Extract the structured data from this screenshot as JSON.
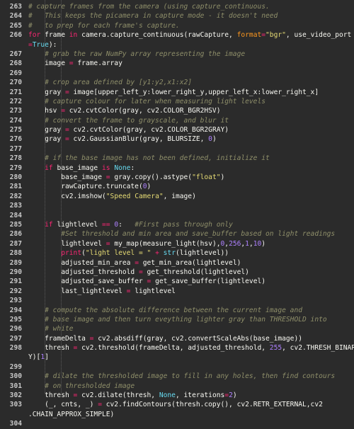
{
  "editor": {
    "lines": [
      {
        "num": "263",
        "indent": 0,
        "tokens": [
          [
            "cm",
            "# capture frames from the camera (using capture_continuous."
          ]
        ]
      },
      {
        "num": "264",
        "indent": 0,
        "tokens": [
          [
            "cm",
            "#   This keeps the picamera in capture mode - it doesn't need"
          ]
        ]
      },
      {
        "num": "265",
        "indent": 0,
        "tokens": [
          [
            "cm",
            "#   to prep for each frame's capture."
          ]
        ]
      },
      {
        "num": "266",
        "indent": 0,
        "tokens": [
          [
            "kw",
            "for"
          ],
          [
            "tx",
            " frame "
          ],
          [
            "kw",
            "in"
          ],
          [
            "tx",
            " camera.capture_continuous(rawCapture, "
          ],
          [
            "pa",
            "format"
          ],
          [
            "op",
            "="
          ],
          [
            "st",
            "\"bgr\""
          ],
          [
            "tx",
            ", use_video_port"
          ]
        ]
      },
      {
        "num": "",
        "indent": 0,
        "tokens": [
          [
            "op",
            "="
          ],
          [
            "bi",
            "True"
          ],
          [
            "tx",
            "):"
          ]
        ]
      },
      {
        "num": "267",
        "indent": 1,
        "tokens": [
          [
            "cm",
            "# grab the raw NumPy array representing the image"
          ]
        ]
      },
      {
        "num": "268",
        "indent": 1,
        "tokens": [
          [
            "tx",
            "image "
          ],
          [
            "op",
            "="
          ],
          [
            "tx",
            " frame.array"
          ]
        ]
      },
      {
        "num": "269",
        "indent": 0,
        "tokens": []
      },
      {
        "num": "270",
        "indent": 1,
        "tokens": [
          [
            "cm",
            "# crop area defined by [y1:y2,x1:x2]"
          ]
        ]
      },
      {
        "num": "271",
        "indent": 1,
        "tokens": [
          [
            "tx",
            "gray "
          ],
          [
            "op",
            "="
          ],
          [
            "tx",
            " image[upper_left_y:lower_right_y,upper_left_x:lower_right_x]"
          ]
        ]
      },
      {
        "num": "272",
        "indent": 1,
        "tokens": [
          [
            "cm",
            "# capture colour for later when measuring light levels"
          ]
        ]
      },
      {
        "num": "273",
        "indent": 1,
        "tokens": [
          [
            "tx",
            "hsv "
          ],
          [
            "op",
            "="
          ],
          [
            "tx",
            " cv2.cvtColor(gray, cv2.COLOR_BGR2HSV)"
          ]
        ]
      },
      {
        "num": "274",
        "indent": 1,
        "tokens": [
          [
            "cm",
            "# convert the frame to grayscale, and blur it"
          ]
        ]
      },
      {
        "num": "275",
        "indent": 1,
        "tokens": [
          [
            "tx",
            "gray "
          ],
          [
            "op",
            "="
          ],
          [
            "tx",
            " cv2.cvtColor(gray, cv2.COLOR_BGR2GRAY)"
          ]
        ]
      },
      {
        "num": "276",
        "indent": 1,
        "tokens": [
          [
            "tx",
            "gray "
          ],
          [
            "op",
            "="
          ],
          [
            "tx",
            " cv2.GaussianBlur(gray, BLURSIZE, "
          ],
          [
            "nu",
            "0"
          ],
          [
            "tx",
            ")"
          ]
        ]
      },
      {
        "num": "277",
        "indent": 0,
        "tokens": []
      },
      {
        "num": "278",
        "indent": 1,
        "tokens": [
          [
            "cm",
            "# if the base image has not been defined, initialize it"
          ]
        ]
      },
      {
        "num": "279",
        "indent": 1,
        "tokens": [
          [
            "kw",
            "if"
          ],
          [
            "tx",
            " base_image "
          ],
          [
            "kw",
            "is"
          ],
          [
            "tx",
            " "
          ],
          [
            "bi",
            "None"
          ],
          [
            "tx",
            ":"
          ]
        ]
      },
      {
        "num": "280",
        "indent": 2,
        "tokens": [
          [
            "tx",
            "base_image "
          ],
          [
            "op",
            "="
          ],
          [
            "tx",
            " gray.copy().astype("
          ],
          [
            "st",
            "\"float\""
          ],
          [
            "tx",
            ")"
          ]
        ]
      },
      {
        "num": "281",
        "indent": 2,
        "tokens": [
          [
            "tx",
            "rawCapture.truncate("
          ],
          [
            "nu",
            "0"
          ],
          [
            "tx",
            ")"
          ]
        ]
      },
      {
        "num": "282",
        "indent": 2,
        "tokens": [
          [
            "tx",
            "cv2.imshow("
          ],
          [
            "st",
            "\"Speed Camera\""
          ],
          [
            "tx",
            ", image)"
          ]
        ]
      },
      {
        "num": "283",
        "indent": 0,
        "tokens": []
      },
      {
        "num": "284",
        "indent": 0,
        "tokens": []
      },
      {
        "num": "285",
        "indent": 1,
        "tokens": [
          [
            "kw",
            "if"
          ],
          [
            "tx",
            " lightlevel "
          ],
          [
            "op",
            "=="
          ],
          [
            "tx",
            " "
          ],
          [
            "nu",
            "0"
          ],
          [
            "tx",
            ":   "
          ],
          [
            "cm",
            "#First pass through only"
          ]
        ]
      },
      {
        "num": "286",
        "indent": 2,
        "tokens": [
          [
            "cm",
            "#Set threshold and min area and save_buffer based on light readings"
          ]
        ]
      },
      {
        "num": "287",
        "indent": 2,
        "tokens": [
          [
            "tx",
            "lightlevel "
          ],
          [
            "op",
            "="
          ],
          [
            "tx",
            " my_map(measure_light(hsv),"
          ],
          [
            "nu",
            "0"
          ],
          [
            "tx",
            ","
          ],
          [
            "nu",
            "256"
          ],
          [
            "tx",
            ","
          ],
          [
            "nu",
            "1"
          ],
          [
            "tx",
            ","
          ],
          [
            "nu",
            "10"
          ],
          [
            "tx",
            ")"
          ]
        ]
      },
      {
        "num": "288",
        "indent": 2,
        "tokens": [
          [
            "kw",
            "print"
          ],
          [
            "tx",
            "("
          ],
          [
            "st",
            "\"light level = \""
          ],
          [
            "tx",
            " "
          ],
          [
            "op",
            "+"
          ],
          [
            "tx",
            " "
          ],
          [
            "bi",
            "str"
          ],
          [
            "tx",
            "(lightlevel))"
          ]
        ]
      },
      {
        "num": "289",
        "indent": 2,
        "tokens": [
          [
            "tx",
            "adjusted_min_area "
          ],
          [
            "op",
            "="
          ],
          [
            "tx",
            " get_min_area(lightlevel)"
          ]
        ]
      },
      {
        "num": "290",
        "indent": 2,
        "tokens": [
          [
            "tx",
            "adjusted_threshold "
          ],
          [
            "op",
            "="
          ],
          [
            "tx",
            " get_threshold(lightlevel)"
          ]
        ]
      },
      {
        "num": "291",
        "indent": 2,
        "tokens": [
          [
            "tx",
            "adjusted_save_buffer "
          ],
          [
            "op",
            "="
          ],
          [
            "tx",
            " get_save_buffer(lightlevel)"
          ]
        ]
      },
      {
        "num": "292",
        "indent": 2,
        "tokens": [
          [
            "tx",
            "last_lightlevel "
          ],
          [
            "op",
            "="
          ],
          [
            "tx",
            " lightlevel"
          ]
        ]
      },
      {
        "num": "293",
        "indent": 0,
        "tokens": []
      },
      {
        "num": "294",
        "indent": 1,
        "tokens": [
          [
            "cm",
            "# compute the absolute difference between the current image and"
          ]
        ]
      },
      {
        "num": "295",
        "indent": 1,
        "tokens": [
          [
            "cm",
            "# base image and then turn eveything lighter gray than THRESHOLD into"
          ]
        ]
      },
      {
        "num": "296",
        "indent": 1,
        "tokens": [
          [
            "cm",
            "# white"
          ]
        ]
      },
      {
        "num": "297",
        "indent": 1,
        "tokens": [
          [
            "tx",
            "frameDelta "
          ],
          [
            "op",
            "="
          ],
          [
            "tx",
            " cv2.absdiff(gray, cv2.convertScaleAbs(base_image))"
          ]
        ]
      },
      {
        "num": "298",
        "indent": 1,
        "tokens": [
          [
            "tx",
            "thresh "
          ],
          [
            "op",
            "="
          ],
          [
            "tx",
            " cv2.threshold(frameDelta, adjusted_threshold, "
          ],
          [
            "nu",
            "255"
          ],
          [
            "tx",
            ", cv2.THRESH_BINAR"
          ]
        ]
      },
      {
        "num": "",
        "indent": 0,
        "tokens": [
          [
            "tx",
            "Y)["
          ],
          [
            "nu",
            "1"
          ],
          [
            "tx",
            "]"
          ]
        ]
      },
      {
        "num": "299",
        "indent": 0,
        "tokens": []
      },
      {
        "num": "300",
        "indent": 1,
        "tokens": [
          [
            "cm",
            "# dilate the thresholded image to fill in any holes, then find contours"
          ]
        ]
      },
      {
        "num": "301",
        "indent": 1,
        "tokens": [
          [
            "cm",
            "# on thresholded image"
          ]
        ]
      },
      {
        "num": "302",
        "indent": 1,
        "tokens": [
          [
            "tx",
            "thresh "
          ],
          [
            "op",
            "="
          ],
          [
            "tx",
            " cv2.dilate(thresh, "
          ],
          [
            "bi",
            "None"
          ],
          [
            "tx",
            ", iterations"
          ],
          [
            "op",
            "="
          ],
          [
            "nu",
            "2"
          ],
          [
            "tx",
            ")"
          ]
        ]
      },
      {
        "num": "303",
        "indent": 1,
        "tokens": [
          [
            "tx",
            "(_, cnts, _) "
          ],
          [
            "op",
            "="
          ],
          [
            "tx",
            " cv2.findContours(thresh.copy(), cv2.RETR_EXTERNAL,cv2"
          ]
        ]
      },
      {
        "num": "",
        "indent": 0,
        "tokens": [
          [
            "tx",
            ".CHAIN_APPROX_SIMPLE)"
          ]
        ]
      },
      {
        "num": "304",
        "indent": 0,
        "tokens": []
      }
    ]
  }
}
